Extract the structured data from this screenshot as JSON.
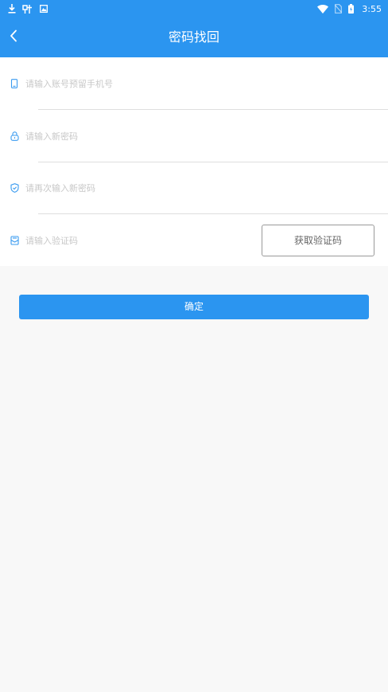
{
  "status_bar": {
    "time": "3:55",
    "icons": [
      "download-icon",
      "app-notification-icon",
      "photo-icon",
      "wifi-icon",
      "no-sim-icon",
      "battery-icon"
    ]
  },
  "header": {
    "title": "密码找回",
    "back_icon": "chevron-left-icon"
  },
  "form": {
    "account": {
      "icon": "phone-icon",
      "placeholder": "请输入账号预留手机号",
      "value": ""
    },
    "new_password": {
      "icon": "lock-icon",
      "placeholder": "请输入新密码",
      "value": ""
    },
    "confirm_password": {
      "icon": "shield-icon",
      "placeholder": "请再次输入新密码",
      "value": ""
    },
    "verification_code": {
      "icon": "mail-icon",
      "placeholder": "请输入验证码",
      "value": ""
    },
    "get_code_label": "获取验证码"
  },
  "confirm_label": "确定",
  "colors": {
    "primary": "#2b95f0",
    "background": "#f8f8f8",
    "placeholder": "#c8c8c8",
    "divider": "#dedede"
  }
}
